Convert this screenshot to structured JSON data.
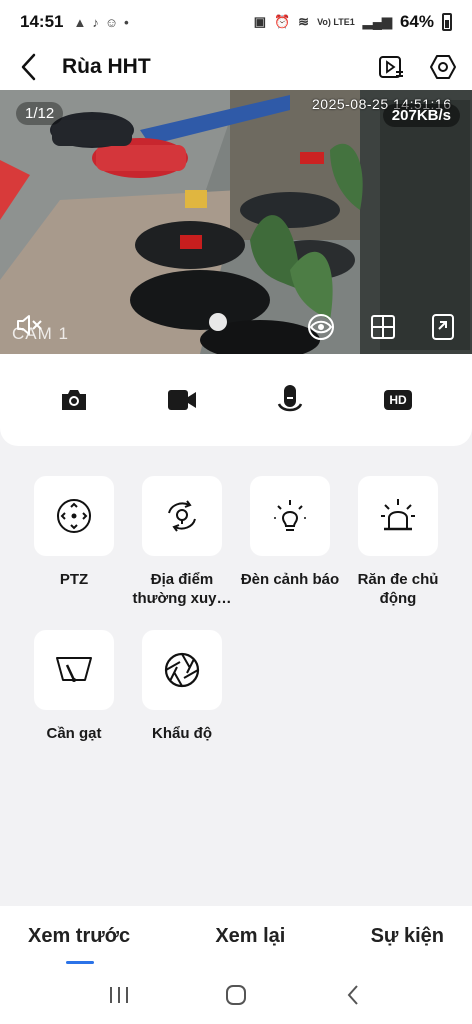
{
  "status_bar": {
    "time": "14:51",
    "network": "Vo) LTE1",
    "battery": "64%"
  },
  "header": {
    "title": "Rùa HHT",
    "icons": [
      "back-icon",
      "playback-list-icon",
      "settings-hexagon-icon"
    ]
  },
  "video": {
    "page": "1/12",
    "timestamp": "2025-08-25 14:51:16",
    "bitrate": "207KB/s",
    "camera_label": "CAM 1",
    "icons": [
      "mute-icon",
      "eye-icon",
      "grid-view-icon",
      "fullscreen-icon"
    ]
  },
  "controls": {
    "icons": [
      "camera-icon",
      "video-record-icon",
      "microphone-icon",
      "hd-icon"
    ],
    "hd_label": "HD"
  },
  "features": [
    {
      "label": "PTZ",
      "icon": "ptz-icon"
    },
    {
      "label": "Địa điểm thường xuy…",
      "icon": "location-icon"
    },
    {
      "label": "Đèn cảnh báo",
      "icon": "warning-light-icon"
    },
    {
      "label": "Răn đe chủ động",
      "icon": "siren-icon"
    },
    {
      "label": "Cần gạt",
      "icon": "wiper-icon"
    },
    {
      "label": "Khẩu độ",
      "icon": "aperture-icon"
    }
  ],
  "tabs": [
    {
      "label": "Xem trước",
      "active": true
    },
    {
      "label": "Xem lại",
      "active": false
    },
    {
      "label": "Sự kiện",
      "active": false
    }
  ],
  "colors": {
    "accent": "#2b73e8",
    "background": "#f2f2f4"
  }
}
